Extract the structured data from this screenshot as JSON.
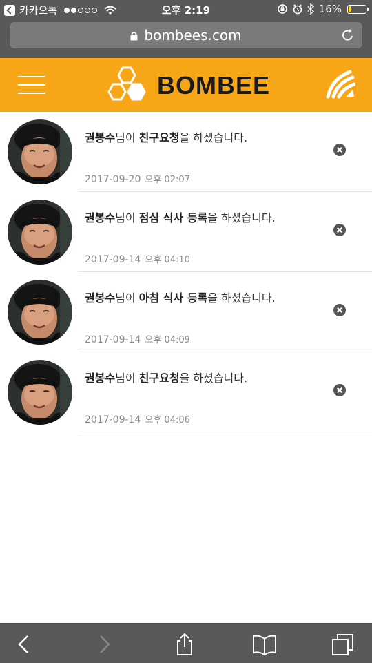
{
  "status_bar": {
    "back_app": "카카오톡",
    "time": "오후 2:19",
    "battery": "16%",
    "battery_level": 0.16
  },
  "browser": {
    "url": "bombees.com"
  },
  "header": {
    "logo_text": "BOMBEE",
    "brand_color": "#f7a618"
  },
  "notifications": [
    {
      "name": "권봉수",
      "p1": "님이 ",
      "action": "친구요청",
      "p2": "을 하셨습니다.",
      "date": "2017-09-20",
      "time": "오후 02:07"
    },
    {
      "name": "권봉수",
      "p1": "님이 ",
      "action": "점심 식사 등록",
      "p2": "을 하셨습니다.",
      "date": "2017-09-14",
      "time": "오후 04:10"
    },
    {
      "name": "권봉수",
      "p1": "님이 ",
      "action": "아침 식사 등록",
      "p2": "을 하셨습니다.",
      "date": "2017-09-14",
      "time": "오후 04:09"
    },
    {
      "name": "권봉수",
      "p1": "님이 ",
      "action": "친구요청",
      "p2": "을 하셨습니다.",
      "date": "2017-09-14",
      "time": "오후 04:06"
    }
  ],
  "icons": {
    "menu": "hamburger-menu-icon",
    "brand": "bombee-wing-icon",
    "close": "close-circle-icon",
    "toolbar": [
      "back-arrow-icon",
      "forward-arrow-icon",
      "share-icon",
      "bookmarks-icon",
      "tabs-icon"
    ]
  }
}
